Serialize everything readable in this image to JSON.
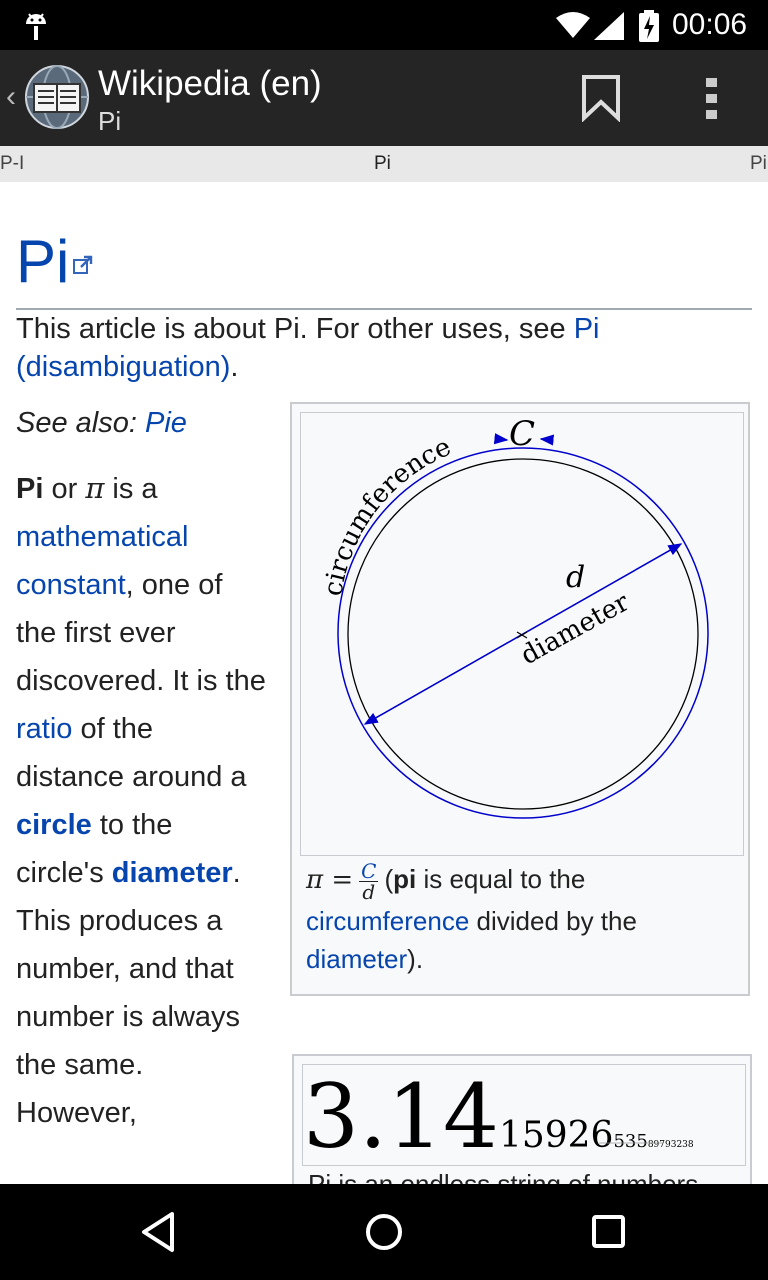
{
  "status_bar": {
    "time": "00:06",
    "icons": [
      "android-debug-icon",
      "wifi-icon",
      "signal-icon",
      "battery-charging-icon"
    ]
  },
  "action_bar": {
    "back_glyph": "‹",
    "title": "Wikipedia (en)",
    "subtitle": "Pi",
    "icons": [
      "wikipedia-globe-icon",
      "bookmark-icon",
      "overflow-menu-icon"
    ]
  },
  "tab_strip": {
    "prev": "P-I",
    "current": "Pi",
    "next": "Pi"
  },
  "article": {
    "title": "Pi",
    "hatnote_text": "This article is about Pi. For other uses, see ",
    "hatnote_link": "Pi (disambiguation)",
    "hatnote_end": ".",
    "see_also_label": "See also: ",
    "see_also_link": "Pie",
    "lead": {
      "b1": "Pi",
      "t1": " or ",
      "pi_symbol": "π",
      "t2": " is a ",
      "link1": "mathematical constant",
      "t3": ", one of the first ever discovered. It is the ",
      "link2": "ratio",
      "t4": " of the distance around a ",
      "link3": "circle",
      "t5": " to the circle's ",
      "link4": "diameter",
      "t6": ". This produces a number, and that number is always the same. However,"
    }
  },
  "figure1": {
    "label_c": "C",
    "label_d": "d",
    "label_circumference": "circumference",
    "label_diameter": "diameter",
    "caption": {
      "formula_lhs": "π =",
      "frac_num": "C",
      "frac_den": "d",
      "open": "(",
      "bold": "pi",
      "t1": " is equal to the ",
      "link1": "circumference",
      "t2": " divided by the ",
      "link2": "diameter",
      "t3": ")."
    },
    "colors": {
      "circle": "#000000",
      "arrows": "#0000cc"
    }
  },
  "figure2": {
    "digits_big": "3.14",
    "digits_mid": "15926",
    "digits_small": "535",
    "digits_tiny": "89793238",
    "caption": "Pi is an endless string of numbers"
  },
  "nav_bar": {
    "icons": [
      "back-triangle-icon",
      "home-circle-icon",
      "recents-square-icon"
    ]
  }
}
